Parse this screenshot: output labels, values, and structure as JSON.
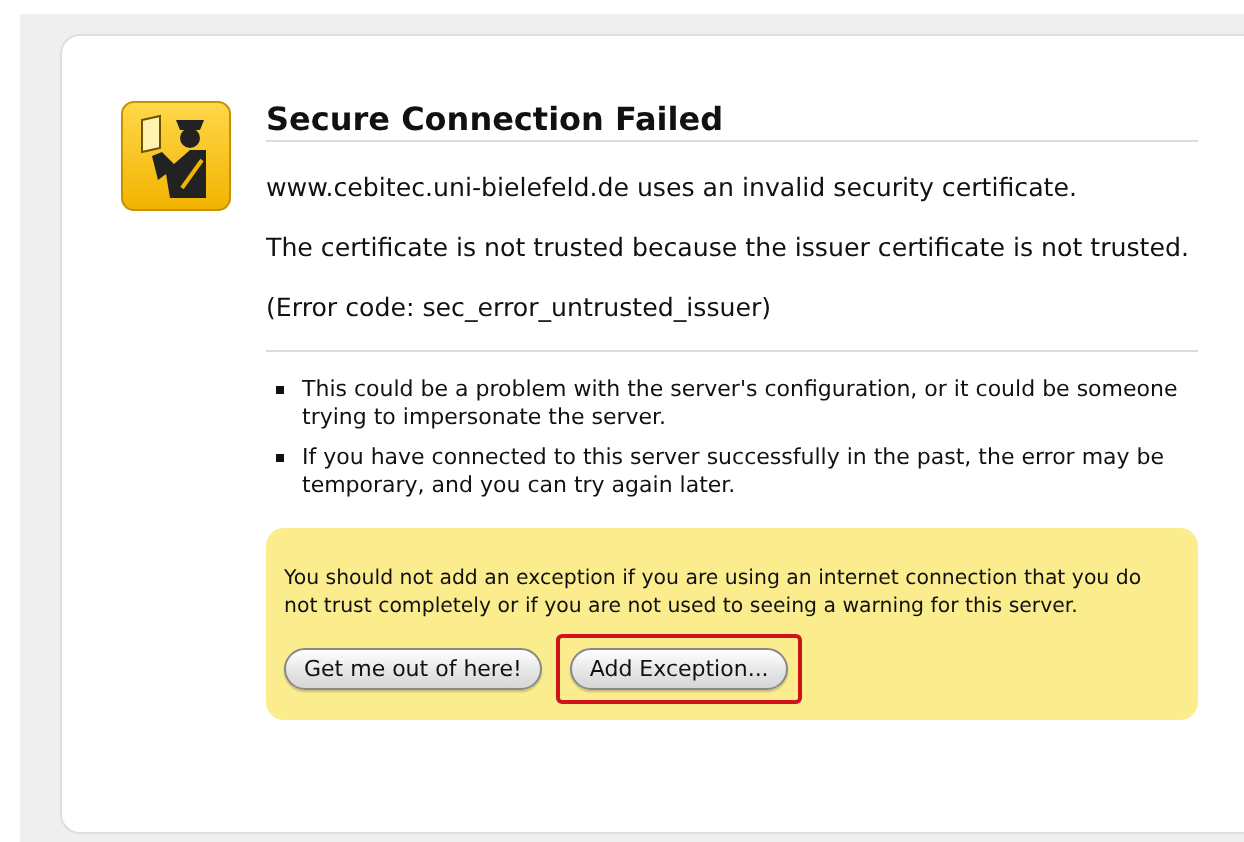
{
  "title": "Secure Connection Failed",
  "paragraphs": [
    "www.cebitec.uni-bielefeld.de uses an invalid security certificate.",
    "The certificate is not trusted because the issuer certificate is not trusted.",
    "(Error code: sec_error_untrusted_issuer)"
  ],
  "bullets": [
    "This could be a problem with the server's configuration, or it could be someone trying to impersonate the server.",
    "If you have connected to this server successfully in the past, the error may be temporary, and you can try again later."
  ],
  "warning": {
    "text": "You should not add an exception if you are using an internet connection that you do not trust completely or if you are not used to seeing a warning for this server.",
    "buttons": [
      {
        "label": "Get me out of here!",
        "highlighted": false
      },
      {
        "label": "Add Exception...",
        "highlighted": true
      }
    ]
  }
}
